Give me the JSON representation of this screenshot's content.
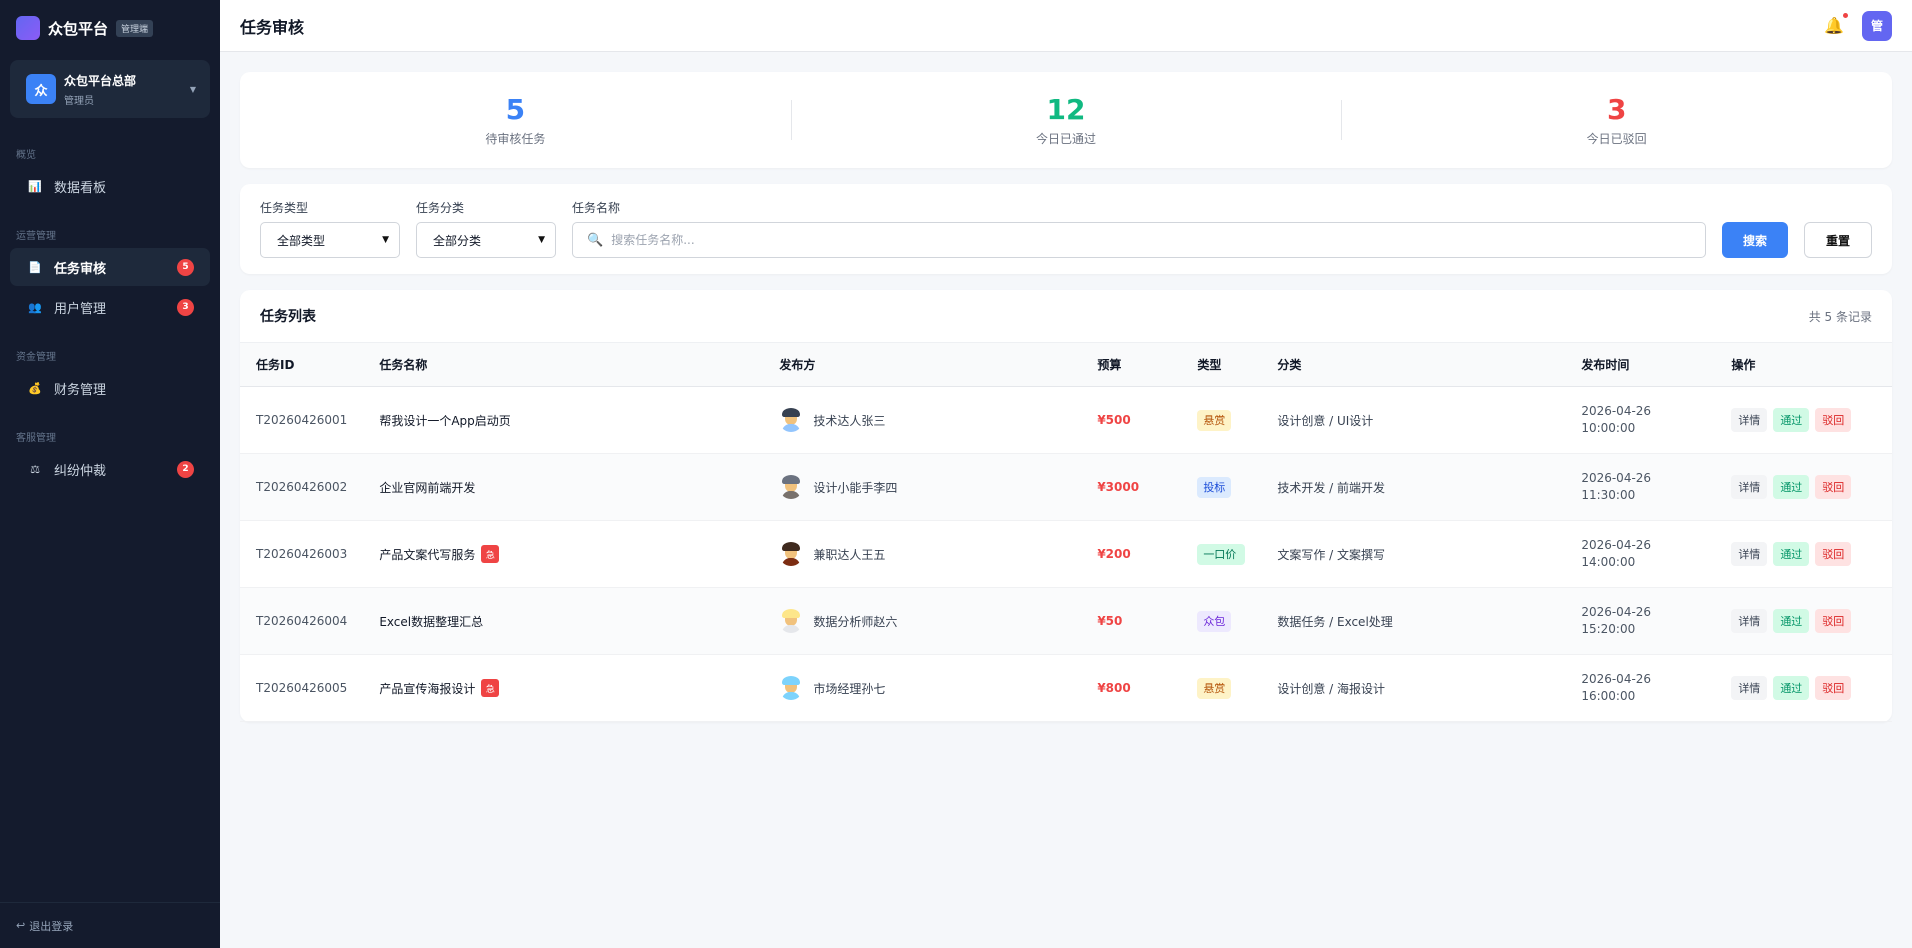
{
  "brand": {
    "name": "众包平台",
    "tag": "管理端"
  },
  "org": {
    "avatar": "众",
    "name": "众包平台总部",
    "role": "管理员"
  },
  "nav": {
    "sections": {
      "overview": "概览",
      "ops": "运营管理",
      "finance": "资金管理",
      "service": "客服管理"
    },
    "items": [
      {
        "label": "数据看板",
        "icon": "chart-icon"
      },
      {
        "label": "任务审核",
        "icon": "document-icon",
        "badge": "5",
        "active": true
      },
      {
        "label": "用户管理",
        "icon": "users-icon",
        "badge": "3"
      },
      {
        "label": "财务管理",
        "icon": "money-bag-icon"
      },
      {
        "label": "纠纷仲裁",
        "icon": "scales-icon",
        "badge": "2"
      }
    ],
    "logout": "退出登录"
  },
  "header": {
    "title": "任务审核",
    "avatar": "管"
  },
  "stats": [
    {
      "value": "5",
      "label": "待审核任务",
      "color": "#3b82f6"
    },
    {
      "value": "12",
      "label": "今日已通过",
      "color": "#10b981"
    },
    {
      "value": "3",
      "label": "今日已驳回",
      "color": "#ef4444"
    }
  ],
  "filters": {
    "type_label": "任务类型",
    "type_value": "全部类型",
    "category_label": "任务分类",
    "category_value": "全部分类",
    "name_label": "任务名称",
    "name_placeholder": "搜索任务名称...",
    "search_button": "搜索",
    "reset_button": "重置"
  },
  "list": {
    "title": "任务列表",
    "count": "共 5 条记录",
    "columns": [
      "任务ID",
      "任务名称",
      "发布方",
      "预算",
      "类型",
      "分类",
      "发布时间",
      "操作"
    ],
    "urgent_label": "急",
    "action_labels": {
      "detail": "详情",
      "pass": "通过",
      "reject": "驳回"
    },
    "rows": [
      {
        "id": "T20260426001",
        "name": "帮我设计一个App启动页",
        "urgent": false,
        "publisher": "技术达人张三",
        "budget": "¥500",
        "type": "悬赏",
        "type_bg": "#fef3c7",
        "type_fg": "#b45309",
        "category": "设计创意 / UI设计",
        "date": "2026-04-26",
        "time": "10:00:00",
        "hair": "#374151",
        "shirt": "#93c5fd"
      },
      {
        "id": "T20260426002",
        "name": "企业官网前端开发",
        "urgent": false,
        "publisher": "设计小能手李四",
        "budget": "¥3000",
        "type": "投标",
        "type_bg": "#dbeafe",
        "type_fg": "#1d4ed8",
        "category": "技术开发 / 前端开发",
        "date": "2026-04-26",
        "time": "11:30:00",
        "hair": "#6b7280",
        "shirt": "#78716c"
      },
      {
        "id": "T20260426003",
        "name": "产品文案代写服务",
        "urgent": true,
        "publisher": "兼职达人王五",
        "budget": "¥200",
        "type": "一口价",
        "type_bg": "#d1fae5",
        "type_fg": "#047857",
        "category": "文案写作 / 文案撰写",
        "date": "2026-04-26",
        "time": "14:00:00",
        "hair": "#3f2a1e",
        "shirt": "#7c2d12"
      },
      {
        "id": "T20260426004",
        "name": "Excel数据整理汇总",
        "urgent": false,
        "publisher": "数据分析师赵六",
        "budget": "¥50",
        "type": "众包",
        "type_bg": "#ede9fe",
        "type_fg": "#6d28d9",
        "category": "数据任务 / Excel处理",
        "date": "2026-04-26",
        "time": "15:20:00",
        "hair": "#fde68a",
        "shirt": "#e5e7eb"
      },
      {
        "id": "T20260426005",
        "name": "产品宣传海报设计",
        "urgent": true,
        "publisher": "市场经理孙七",
        "budget": "¥800",
        "type": "悬赏",
        "type_bg": "#fef3c7",
        "type_fg": "#b45309",
        "category": "设计创意 / 海报设计",
        "date": "2026-04-26",
        "time": "16:00:00",
        "hair": "#7dd3fc",
        "shirt": "#7dd3fc"
      }
    ]
  }
}
